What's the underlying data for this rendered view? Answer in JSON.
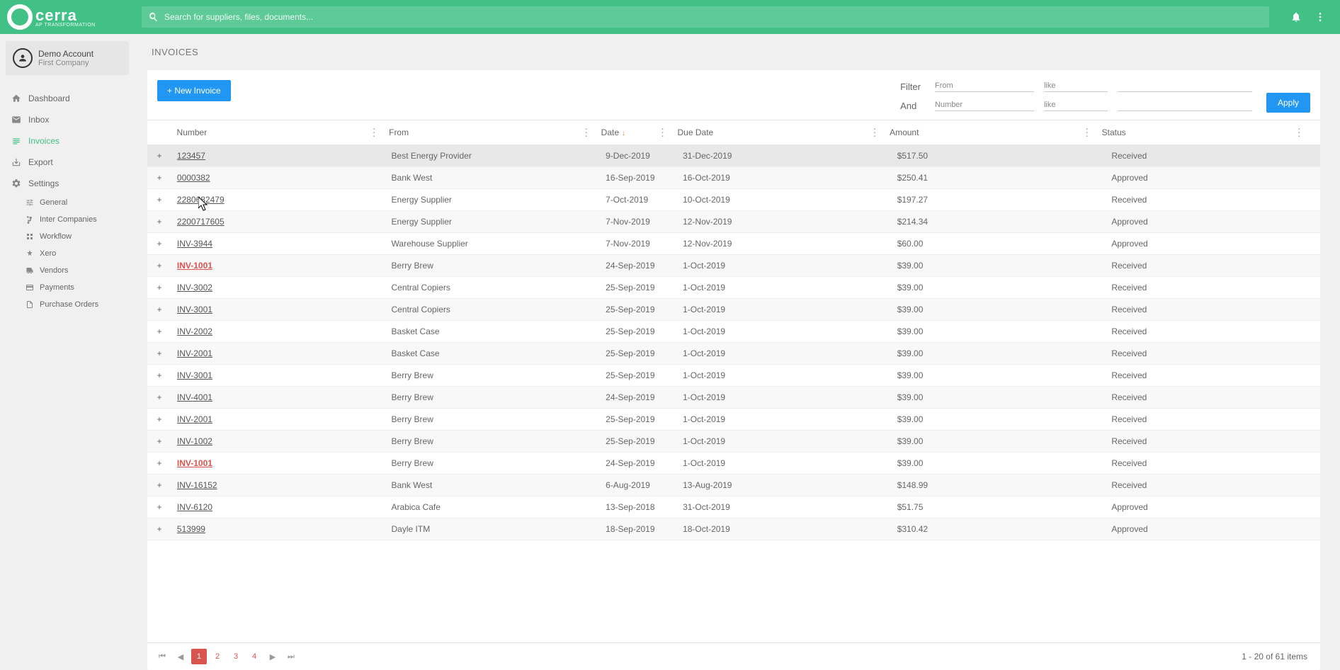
{
  "brand": {
    "name": "cerra",
    "tagline": "AP TRANSFORMATION"
  },
  "search": {
    "placeholder": "Search for suppliers, files, documents..."
  },
  "account": {
    "name": "Demo Account",
    "company": "First Company"
  },
  "nav": {
    "dashboard": "Dashboard",
    "inbox": "Inbox",
    "invoices": "Invoices",
    "export": "Export",
    "settings": "Settings",
    "general": "General",
    "intercompanies": "Inter Companies",
    "workflow": "Workflow",
    "xero": "Xero",
    "vendors": "Vendors",
    "payments": "Payments",
    "purchaseorders": "Purchase Orders"
  },
  "page": {
    "title": "INVOICES"
  },
  "actions": {
    "newInvoice": "+ New Invoice",
    "apply": "Apply"
  },
  "filter": {
    "label1": "Filter",
    "label2": "And",
    "fieldA": "From",
    "opA": "like",
    "valA": "",
    "fieldB": "Number",
    "opB": "like",
    "valB": ""
  },
  "columns": {
    "number": "Number",
    "from": "From",
    "date": "Date",
    "due": "Due Date",
    "amount": "Amount",
    "status": "Status"
  },
  "rows": [
    {
      "num": "123457",
      "alert": false,
      "from": "Best Energy Provider",
      "date": "9-Dec-2019",
      "due": "31-Dec-2019",
      "amt": "$517.50",
      "status": "Received"
    },
    {
      "num": "0000382",
      "alert": false,
      "from": "Bank West",
      "date": "16-Sep-2019",
      "due": "16-Oct-2019",
      "amt": "$250.41",
      "status": "Approved"
    },
    {
      "num": "2280682479",
      "alert": false,
      "from": "Energy Supplier",
      "date": "7-Oct-2019",
      "due": "10-Oct-2019",
      "amt": "$197.27",
      "status": "Received"
    },
    {
      "num": "2200717605",
      "alert": false,
      "from": "Energy Supplier",
      "date": "7-Nov-2019",
      "due": "12-Nov-2019",
      "amt": "$214.34",
      "status": "Approved"
    },
    {
      "num": "INV-3944",
      "alert": false,
      "from": "Warehouse Supplier",
      "date": "7-Nov-2019",
      "due": "12-Nov-2019",
      "amt": "$60.00",
      "status": "Approved"
    },
    {
      "num": "INV-1001",
      "alert": true,
      "from": "Berry Brew",
      "date": "24-Sep-2019",
      "due": "1-Oct-2019",
      "amt": "$39.00",
      "status": "Received"
    },
    {
      "num": "INV-3002",
      "alert": false,
      "from": "Central Copiers",
      "date": "25-Sep-2019",
      "due": "1-Oct-2019",
      "amt": "$39.00",
      "status": "Received"
    },
    {
      "num": "INV-3001",
      "alert": false,
      "from": "Central Copiers",
      "date": "25-Sep-2019",
      "due": "1-Oct-2019",
      "amt": "$39.00",
      "status": "Received"
    },
    {
      "num": "INV-2002",
      "alert": false,
      "from": "Basket Case",
      "date": "25-Sep-2019",
      "due": "1-Oct-2019",
      "amt": "$39.00",
      "status": "Received"
    },
    {
      "num": "INV-2001",
      "alert": false,
      "from": "Basket Case",
      "date": "25-Sep-2019",
      "due": "1-Oct-2019",
      "amt": "$39.00",
      "status": "Received"
    },
    {
      "num": "INV-3001",
      "alert": false,
      "from": "Berry Brew",
      "date": "25-Sep-2019",
      "due": "1-Oct-2019",
      "amt": "$39.00",
      "status": "Received"
    },
    {
      "num": "INV-4001",
      "alert": false,
      "from": "Berry Brew",
      "date": "24-Sep-2019",
      "due": "1-Oct-2019",
      "amt": "$39.00",
      "status": "Received"
    },
    {
      "num": "INV-2001",
      "alert": false,
      "from": "Berry Brew",
      "date": "25-Sep-2019",
      "due": "1-Oct-2019",
      "amt": "$39.00",
      "status": "Received"
    },
    {
      "num": "INV-1002",
      "alert": false,
      "from": "Berry Brew",
      "date": "25-Sep-2019",
      "due": "1-Oct-2019",
      "amt": "$39.00",
      "status": "Received"
    },
    {
      "num": "INV-1001",
      "alert": true,
      "from": "Berry Brew",
      "date": "24-Sep-2019",
      "due": "1-Oct-2019",
      "amt": "$39.00",
      "status": "Received"
    },
    {
      "num": "INV-16152",
      "alert": false,
      "from": "Bank West",
      "date": "6-Aug-2019",
      "due": "13-Aug-2019",
      "amt": "$148.99",
      "status": "Received"
    },
    {
      "num": "INV-6120",
      "alert": false,
      "from": "Arabica Cafe",
      "date": "13-Sep-2018",
      "due": "31-Oct-2019",
      "amt": "$51.75",
      "status": "Approved"
    },
    {
      "num": "513999",
      "alert": false,
      "from": "Dayle ITM",
      "date": "18-Sep-2019",
      "due": "18-Oct-2019",
      "amt": "$310.42",
      "status": "Approved"
    }
  ],
  "pager": {
    "pages": [
      "1",
      "2",
      "3",
      "4"
    ],
    "active": 0,
    "info": "1 - 20 of 61 items"
  }
}
